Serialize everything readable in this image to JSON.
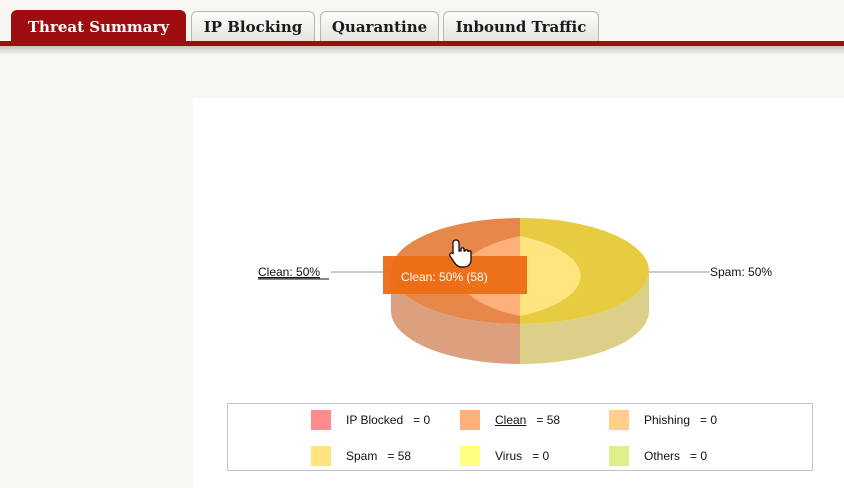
{
  "tabs": [
    {
      "label": "Threat Summary",
      "active": true
    },
    {
      "label": "IP Blocking",
      "active": false
    },
    {
      "label": "Quarantine",
      "active": false
    },
    {
      "label": "Inbound Traffic",
      "active": false
    }
  ],
  "colors": {
    "tab_active": "#a00d10",
    "ip_blocked": "#ff8c8c",
    "clean": "#ffb07a",
    "phishing": "#ffce8a",
    "spam": "#ffe480",
    "virus": "#ffff80",
    "others": "#dcef8c"
  },
  "chart_data": {
    "type": "pie",
    "slices": [
      {
        "name": "Clean",
        "value": 58,
        "percent": 50
      },
      {
        "name": "Spam",
        "value": 58,
        "percent": 50
      }
    ],
    "slice_labels": {
      "left": "Clean: 50%",
      "right": "Spam: 50%"
    },
    "tooltip": "Clean: 50% (58)",
    "legend": [
      {
        "label": "IP Blocked",
        "value": "= 0",
        "color_key": "ip_blocked",
        "link": false
      },
      {
        "label": "Clean",
        "value": "= 58",
        "color_key": "clean",
        "link": true
      },
      {
        "label": "Phishing",
        "value": "= 0",
        "color_key": "phishing",
        "link": false
      },
      {
        "label": "Spam",
        "value": "= 58",
        "color_key": "spam",
        "link": false
      },
      {
        "label": "Virus",
        "value": "= 0",
        "color_key": "virus",
        "link": false
      },
      {
        "label": "Others",
        "value": "= 0",
        "color_key": "others",
        "link": false
      }
    ],
    "legend_placement": "bottom"
  }
}
